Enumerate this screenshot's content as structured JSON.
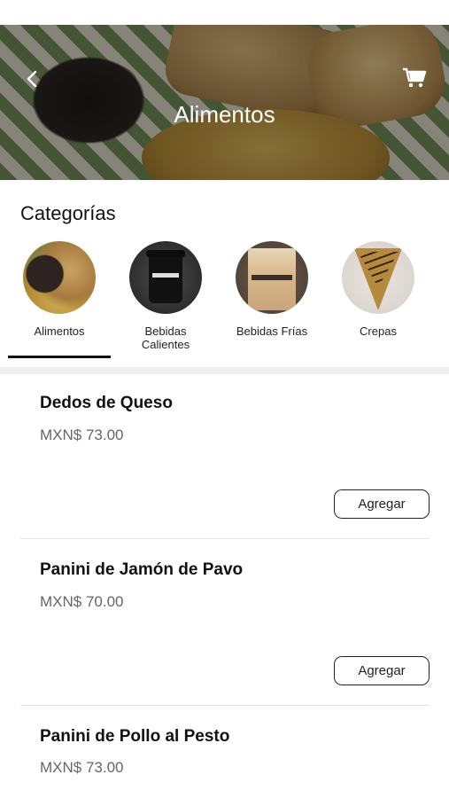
{
  "header": {
    "title": "Alimentos",
    "back_icon": "chevron-left-icon",
    "cart_icon": "shopping-cart-icon"
  },
  "categories": {
    "heading": "Categorías",
    "items": [
      {
        "label": "Alimentos",
        "selected": true
      },
      {
        "label": "Bebidas\nCalientes",
        "selected": false
      },
      {
        "label": "Bebidas Frías",
        "selected": false
      },
      {
        "label": "Crepas",
        "selected": false
      }
    ]
  },
  "products": [
    {
      "name": "Dedos de Queso",
      "price": "MXN$ 73.00",
      "button": "Agregar"
    },
    {
      "name": "Panini de Jamón de Pavo",
      "price": "MXN$ 70.00",
      "button": "Agregar"
    },
    {
      "name": "Panini de Pollo al Pesto",
      "price": "MXN$ 73.00",
      "button": "Agregar"
    }
  ],
  "colors": {
    "text": "#111111",
    "price": "#666666",
    "divider": "#eeeeee"
  }
}
